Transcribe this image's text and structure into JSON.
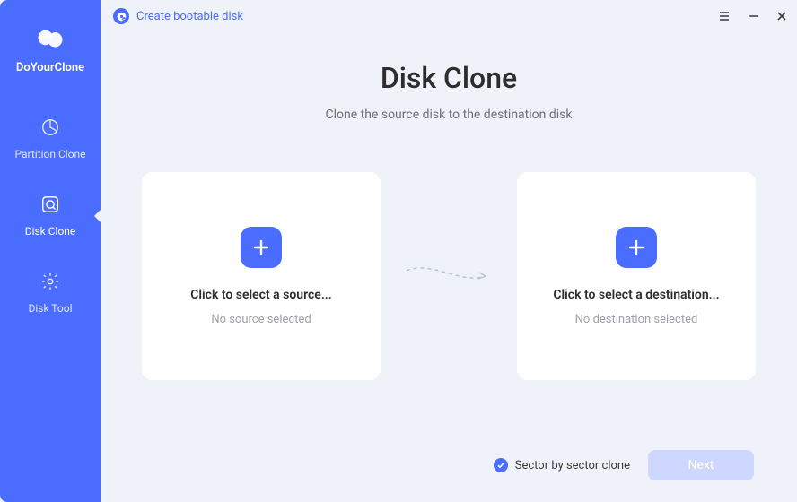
{
  "brand": {
    "name": "DoYourClone"
  },
  "nav": {
    "items": [
      {
        "key": "partition-clone",
        "label": "Partition Clone"
      },
      {
        "key": "disk-clone",
        "label": "Disk Clone"
      },
      {
        "key": "disk-tool",
        "label": "Disk Tool"
      }
    ]
  },
  "topbar": {
    "bootable_label": "Create bootable disk"
  },
  "page": {
    "title": "Disk Clone",
    "subtitle": "Clone the source disk to the destination disk"
  },
  "source_card": {
    "title": "Click to select a source...",
    "subtitle": "No source selected"
  },
  "dest_card": {
    "title": "Click to select a destination...",
    "subtitle": "No destination selected"
  },
  "footer": {
    "sector_label": "Sector by sector clone",
    "next_label": "Next"
  }
}
